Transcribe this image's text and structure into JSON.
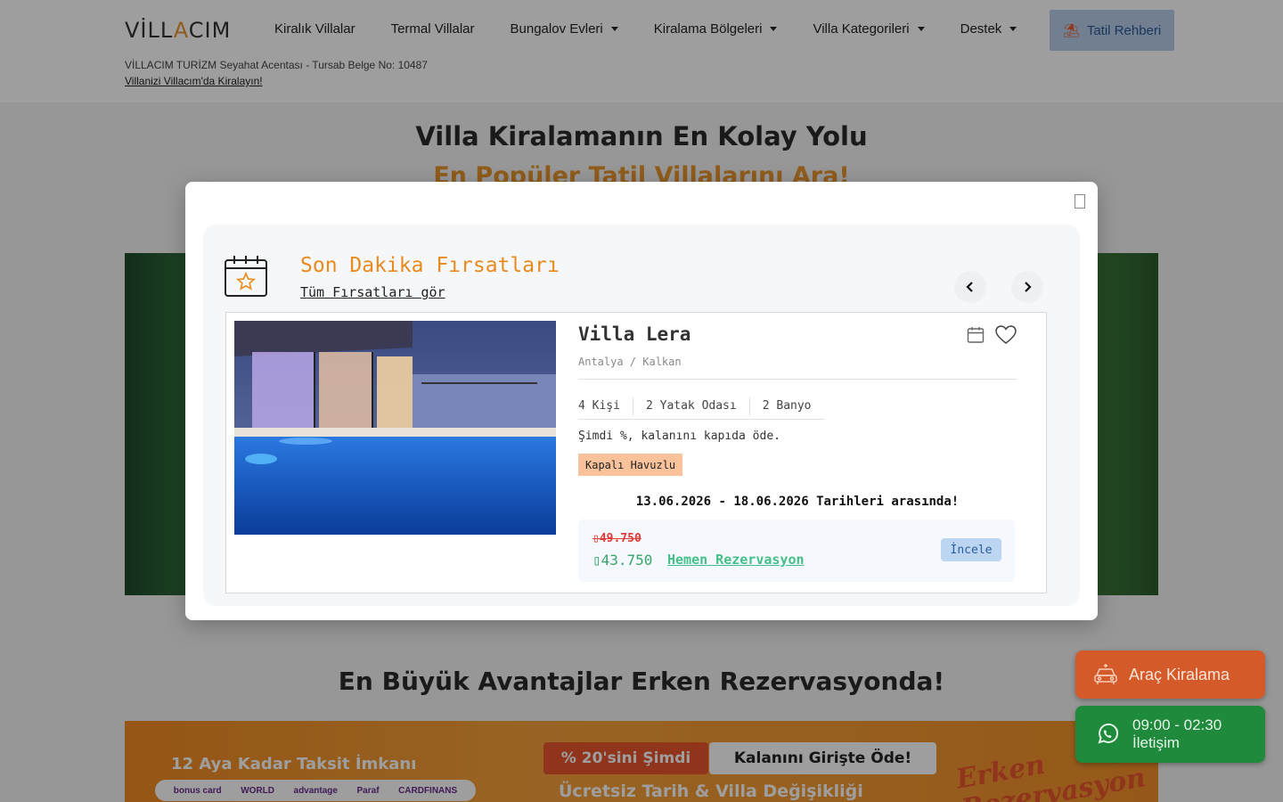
{
  "header": {
    "logo": "VİLLACIM",
    "nav": [
      {
        "label": "Kiralık Villalar",
        "dropdown": false
      },
      {
        "label": "Termal Villalar",
        "dropdown": false
      },
      {
        "label": "Bungalov Evleri",
        "dropdown": true
      },
      {
        "label": "Kiralama Bölgeleri",
        "dropdown": true
      },
      {
        "label": "Villa Kategorileri",
        "dropdown": true
      },
      {
        "label": "Destek",
        "dropdown": true
      }
    ],
    "guide_button": "Tatil Rehberi",
    "agency_text": "VİLLACIM TURİZM Seyahat Acentası - Tursab Belge No: 10487",
    "list_villa_link": "Villanizi Villacım'da Kiralayın!"
  },
  "hero": {
    "title": "Villa Kiralamanın En Kolay Yolu",
    "subtitle": "En Popüler Tatil Villalarını Ara!"
  },
  "section": {
    "title": "En Büyük Avantajlar Erken Rezervasyonda!"
  },
  "banner": {
    "installment": "12 Aya Kadar Taksit İmkanı",
    "cards": [
      "bonus card",
      "WORLD",
      "advantage",
      "Paraf",
      "CARDFINANS"
    ],
    "percent": "% 20'sini Şimdi",
    "pay_rest": "Kalanını Girişte Öde!",
    "free_change": "Ücretsiz Tarih & Villa Değişikliği",
    "early": "Erken Rezervasyon"
  },
  "floating": {
    "car_rental": "Araç Kiralama",
    "whatsapp_hours": "09:00 - 02:30",
    "whatsapp_label": "İletişim"
  },
  "modal": {
    "title": "Son Dakika Fırsatları",
    "see_all": "Tüm Fırsatları gör",
    "villa": {
      "name": "Villa Lera",
      "location": "Antalya / Kalkan",
      "specs": [
        "4 Kişi",
        "2 Yatak Odası",
        "2 Banyo"
      ],
      "payment_note": "Şimdi %, kalanını kapıda öde.",
      "tag": "Kapalı Havuzlu",
      "dates": "13.06.2026 - 18.06.2026 Tarihleri arasında!",
      "old_price": "49.750",
      "new_price": "43.750",
      "reserve_link": "Hemen Rezervasyon",
      "review_button": "İncele"
    }
  },
  "colors": {
    "accent": "#e8952e",
    "car_button": "#d55a2a",
    "whatsapp": "#1f8a3c",
    "price_new": "#35a56a",
    "price_old": "#e53935"
  }
}
